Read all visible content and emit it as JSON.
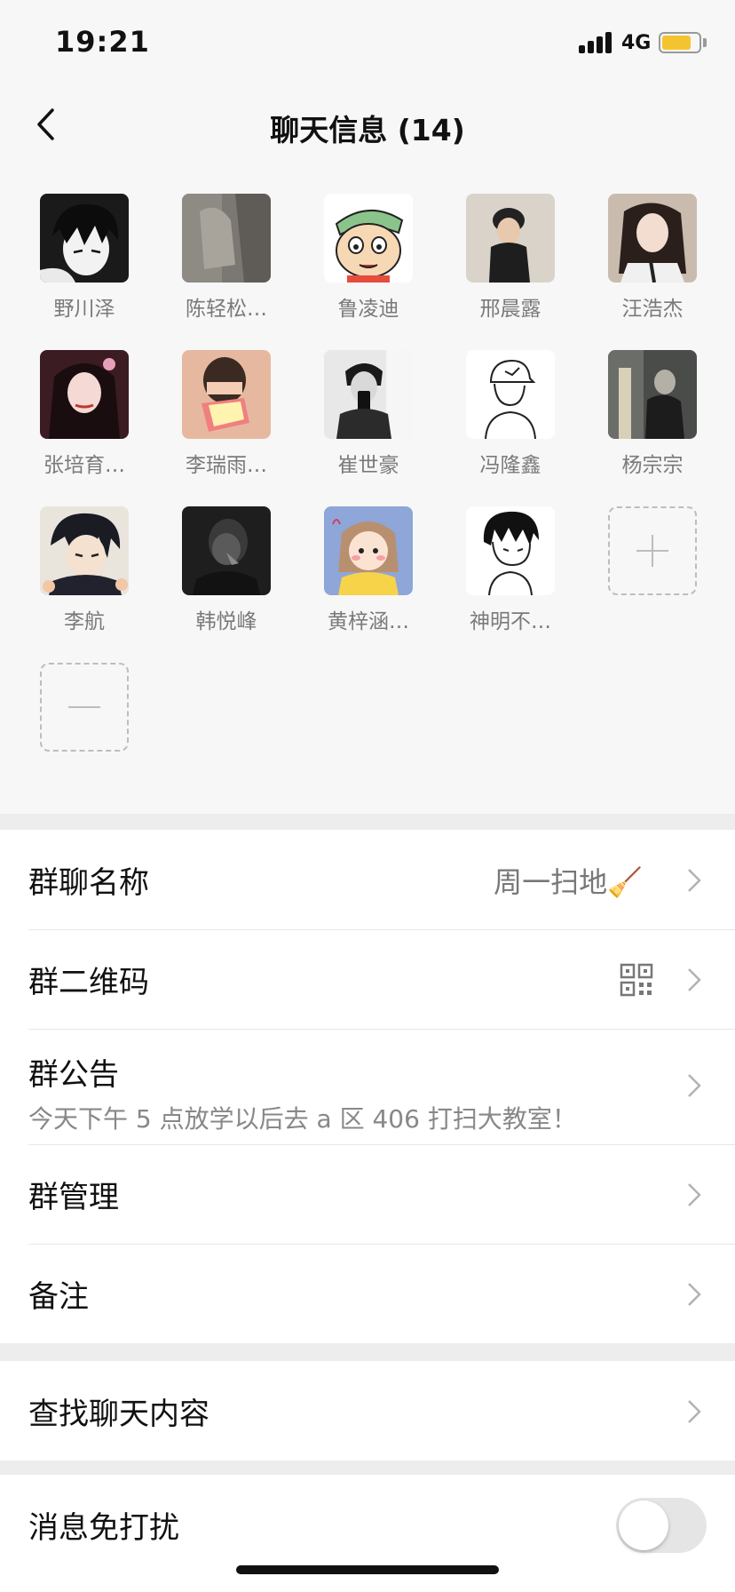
{
  "status_bar": {
    "time": "19:21",
    "network": "4G",
    "battery_level": 0.8,
    "battery_color": "#f4c430"
  },
  "nav": {
    "title": "聊天信息 (14)"
  },
  "members": [
    {
      "name": "野川泽",
      "avatar": "anime-boy"
    },
    {
      "name": "陈轻松…",
      "avatar": "texture-photo"
    },
    {
      "name": "鲁凌迪",
      "avatar": "crayon-shin-chan"
    },
    {
      "name": "邢晨露",
      "avatar": "girl-photo"
    },
    {
      "name": "汪浩杰",
      "avatar": "girl-photo"
    },
    {
      "name": "张培育…",
      "avatar": "girl-photo"
    },
    {
      "name": "李瑞雨…",
      "avatar": "hidden-face-photo"
    },
    {
      "name": "崔世豪",
      "avatar": "mirror-selfie"
    },
    {
      "name": "冯隆鑫",
      "avatar": "line-drawing-cap"
    },
    {
      "name": "杨宗宗",
      "avatar": "dark-room-photo"
    },
    {
      "name": "李航",
      "avatar": "anime-ninja"
    },
    {
      "name": "韩悦峰",
      "avatar": "dark-portrait"
    },
    {
      "name": "黄梓涵…",
      "avatar": "cartoon-girl"
    },
    {
      "name": "神明不…",
      "avatar": "sketch-boy"
    }
  ],
  "member_actions": {
    "add": "add-member",
    "remove": "remove-member"
  },
  "settings": {
    "group_name": {
      "label": "群聊名称",
      "value": "周一扫地🧹"
    },
    "qr_code": {
      "label": "群二维码"
    },
    "announcement": {
      "label": "群公告",
      "text": "今天下午 5 点放学以后去 a 区 406 打扫大教室！"
    },
    "management": {
      "label": "群管理"
    },
    "remark": {
      "label": "备注"
    },
    "search": {
      "label": "查找聊天内容"
    },
    "mute": {
      "label": "消息免打扰",
      "enabled": false
    }
  }
}
